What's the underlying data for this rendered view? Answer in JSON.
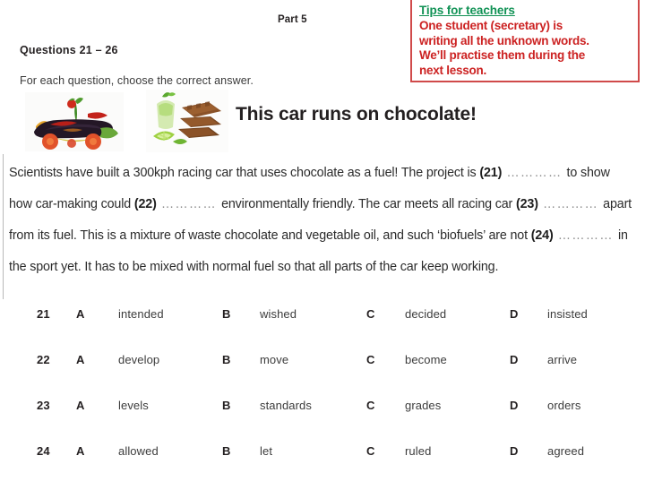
{
  "tips": {
    "heading": "Tips for teachers",
    "lines": [
      "One student (secretary) is",
      "writing all the unknown words.",
      "We’ll practise them during the",
      "next lesson."
    ],
    "heading_color": "#119255",
    "body_color": "#cc2222",
    "border_color": "#d04a4a"
  },
  "exam": {
    "part_title": "Part 5",
    "questions_range": "Questions 21 – 26",
    "instruction": "For each question, choose the correct answer."
  },
  "article": {
    "headline": "This car runs on chocolate!",
    "images": [
      {
        "name": "vegetable-car-photo",
        "alt": "Toy car sculpted from vegetables: aubergine body, tomato wheels"
      },
      {
        "name": "chocolate-lime-photo",
        "alt": "Stacked chocolate squares with lime slices and a green drink"
      }
    ],
    "text_parts": {
      "s1": "Scientists have built a 300kph racing car that uses chocolate as a fuel! The project is ",
      "n21": "(21)",
      "gap21": " ………… ",
      "s2": "to show how car-making could ",
      "n22": "(22)",
      "gap22": " ………… ",
      "s3": "environmentally friendly. The car meets all racing car ",
      "n23": "(23)",
      "gap23": " ………… ",
      "s4": "apart from its fuel. This is a mixture of waste chocolate and vegetable oil, and such ‘biofuels’ are not ",
      "n24": "(24)",
      "gap24": " ………… ",
      "s5": "in the sport yet. It has to be mixed with normal fuel so that all parts of the car keep working."
    }
  },
  "answers": [
    {
      "number": "21",
      "options": [
        {
          "letter": "A",
          "word": "intended"
        },
        {
          "letter": "B",
          "word": "wished"
        },
        {
          "letter": "C",
          "word": "decided"
        },
        {
          "letter": "D",
          "word": "insisted"
        }
      ]
    },
    {
      "number": "22",
      "options": [
        {
          "letter": "A",
          "word": "develop"
        },
        {
          "letter": "B",
          "word": "move"
        },
        {
          "letter": "C",
          "word": "become"
        },
        {
          "letter": "D",
          "word": "arrive"
        }
      ]
    },
    {
      "number": "23",
      "options": [
        {
          "letter": "A",
          "word": "levels"
        },
        {
          "letter": "B",
          "word": "standards"
        },
        {
          "letter": "C",
          "word": "grades"
        },
        {
          "letter": "D",
          "word": "orders"
        }
      ]
    },
    {
      "number": "24",
      "options": [
        {
          "letter": "A",
          "word": "allowed"
        },
        {
          "letter": "B",
          "word": "let"
        },
        {
          "letter": "C",
          "word": "ruled"
        },
        {
          "letter": "D",
          "word": "agreed"
        }
      ]
    }
  ]
}
